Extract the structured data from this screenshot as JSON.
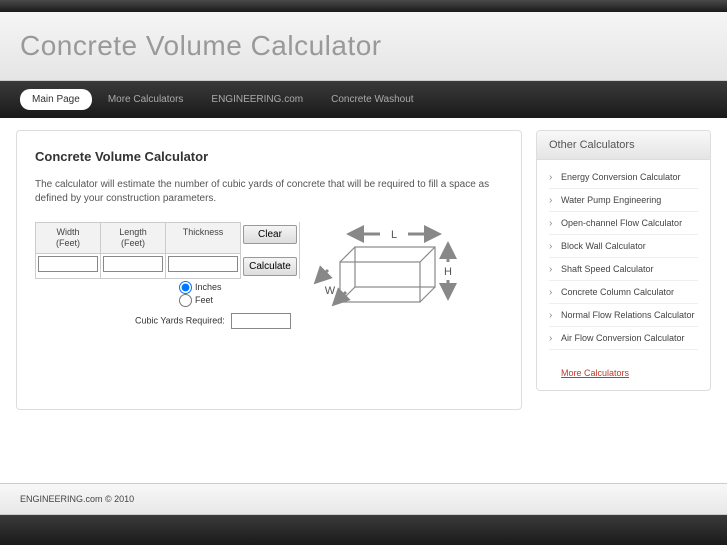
{
  "header": {
    "title": "Concrete Volume Calculator"
  },
  "nav": {
    "items": [
      {
        "label": "Main Page",
        "active": true
      },
      {
        "label": "More Calculators"
      },
      {
        "label": "ENGINEERING.com"
      },
      {
        "label": "Concrete Washout"
      }
    ]
  },
  "main": {
    "heading": "Concrete Volume Calculator",
    "description": "The calculator will estimate the number of cubic yards of concrete that will be required to fill a space as defined by your construction parameters.",
    "headers": {
      "width": "Width\n(Feet)",
      "length": "Length\n(Feet)",
      "thickness": "Thickness"
    },
    "buttons": {
      "clear": "Clear",
      "calculate": "Calculate"
    },
    "units": {
      "inches": "Inches",
      "feet": "Feet"
    },
    "result_label": "Cubic Yards Required:",
    "diagram": {
      "L": "L",
      "W": "W",
      "H": "H"
    }
  },
  "sidebar": {
    "title": "Other Calculators",
    "items": [
      "Energy Conversion Calculator",
      "Water Pump Engineering",
      "Open-channel Flow Calculator",
      "Block Wall Calculator",
      "Shaft Speed Calculator",
      "Concrete Column Calculator",
      "Normal Flow Relations Calculator",
      "Air Flow Conversion Calculator"
    ],
    "more": "More Calculators"
  },
  "footer": {
    "copyright": "ENGINEERING.com © 2010"
  }
}
